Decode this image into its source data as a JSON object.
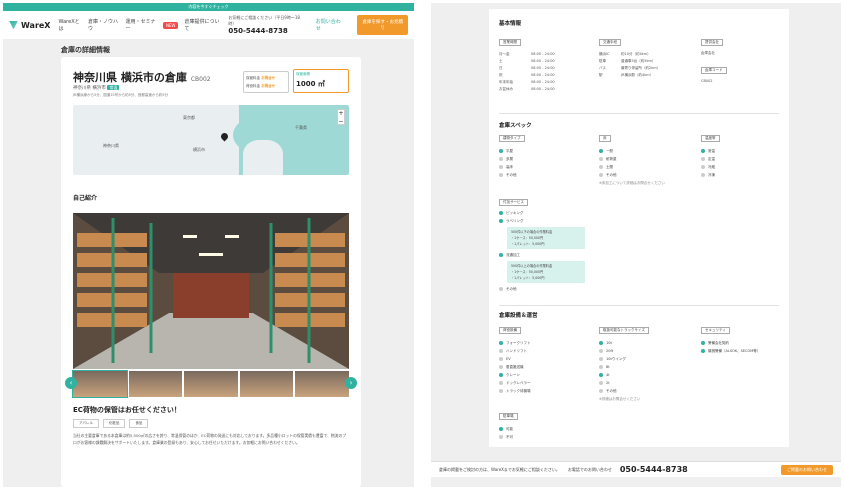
{
  "banner": "内容を今すぐチェック",
  "header": {
    "logo": "WareX",
    "nav": [
      "WareXとは",
      "倉庫・ノウハウ",
      "運用・セミナー",
      "NEW",
      "倉庫提供について"
    ],
    "phone_caption": "お気軽にご相談ください（平日9時〜18時）",
    "phone": "050-5444-8738",
    "inquiry": "お問い合わせ",
    "cta": "倉庫を探す・お見積り"
  },
  "page_title": "倉庫の詳細情報",
  "warehouse": {
    "name": "神奈川県 横浜市の倉庫",
    "code": "CB002",
    "sub": "神奈川県 横浜市",
    "sub_tag": "常温",
    "access": "JR横浜線から5分、国道15号から約5分、首都高速から約5分",
    "price_label1": "保管料金",
    "price_label2": "荷役料金",
    "price_value": "お問合せ",
    "area_label": "保管面積",
    "area_value": "1000 ㎡"
  },
  "map": {
    "labels": [
      "東京都",
      "横浜市",
      "神奈川県",
      "千葉県"
    ],
    "zoom_in": "+",
    "zoom_out": "−"
  },
  "intro_heading": "自己紹介",
  "promo": "EC荷物の保管はお任せください！",
  "tags": [
    "アパレル",
    "化粧品",
    "食品"
  ],
  "description": "当社の主要倉庫である本倉庫は約5,500㎡の広さを誇り、常温保管のほか、EC荷物の発送にも対応しております。多品種小ロットの保管実績も豊富で、物流のプロがお客様の課題解決をサポートいたします。倉庫業の登録もあり、安心してお任せいただけます。お気軽にお問い合わせください。",
  "right": {
    "basic": "基本情報",
    "hours_tag": "営業時間",
    "days": [
      "月〜金",
      "土",
      "日",
      "祝",
      "年末年始",
      "お盆休み"
    ],
    "hours": [
      "08:00 - 24:00",
      "08:00 - 24:00",
      "08:00 - 24:00",
      "08:00 - 24:00",
      "08:00 - 24:00",
      "08:00 - 24:00"
    ],
    "access_tag": "交通手段",
    "access_rows": [
      [
        "横浜IC",
        "約10分（約4km）"
      ],
      [
        "駐車",
        "普通車5台（約5km）"
      ],
      [
        "バス",
        "最寄り停留所（約2km）"
      ],
      [
        "駅",
        "JR横浜駅（約4km）"
      ]
    ],
    "company_tag": "提供会社",
    "company": "倉庫会社",
    "id_tag": "倉庫コード",
    "id": "CB002",
    "spec": "倉庫スペック",
    "spec1_tag": "建物タイプ",
    "spec1": [
      "平屋",
      "多層",
      "高床",
      "その他"
    ],
    "spec2_tag": "床",
    "spec2": [
      "一般",
      "耐荷重",
      "土間",
      "その他"
    ],
    "spec2_note": "※床加工について詳細はお問合せください",
    "spec3_tag": "温度帯",
    "spec3": [
      "常温",
      "定温",
      "冷蔵",
      "冷凍"
    ],
    "service_tag": "付加サービス",
    "service": [
      "ピッキング",
      "ラベリング",
      "流通加工",
      "その他"
    ],
    "note1": "500件以下の場合の作業料金\n・1ケース：50,000円\n・1パレット：5,000円",
    "note2": "500件以上の場合の作業料金\n・1ケース：50,000円\n・1パレット：5,000円",
    "equip": "倉庫設備＆運営",
    "equip1_tag": "荷役設備",
    "equip1": [
      "フォークリフト",
      "ハンドリフト",
      "EV",
      "垂直搬送機",
      "クレーン",
      "ドックレベラー",
      "トラック待機場"
    ],
    "equip2_tag": "取扱可能なトラックサイズ",
    "equip2": [
      "10t",
      "20ft",
      "10tウイング",
      "8t",
      "4t",
      "2t",
      "その他"
    ],
    "equip2_note": "※詳細はお問合せください",
    "equip3_tag": "セキュリティ",
    "equip3": [
      "警備会社契約",
      "機械警備（ALSOK、SECOM等）"
    ],
    "staff_tag": "駐車場",
    "staff": [
      "可能",
      "不可"
    ]
  },
  "footer": {
    "text": "倉庫の掲載をご検討の方は、WareXまでお気軽にご相談ください。",
    "phone_caption": "お電話でのお問い合わせ",
    "phone": "050-5444-8738",
    "button": "ご掲載のお問い合わせ"
  }
}
